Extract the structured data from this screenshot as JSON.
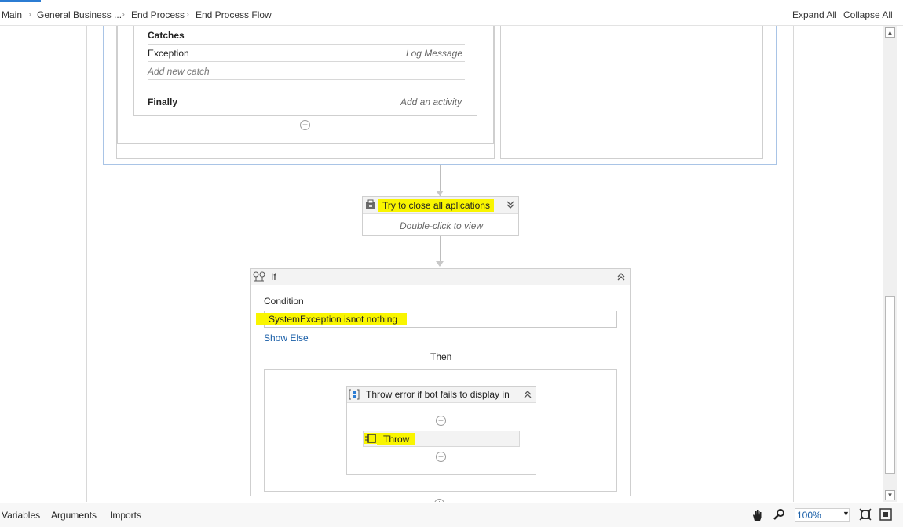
{
  "breadcrumb": [
    "Main",
    "General Business ...",
    "End Process",
    "End Process Flow"
  ],
  "header": {
    "expand_all": "Expand All",
    "collapse_all": "Collapse All"
  },
  "try_catch": {
    "catches_label": "Catches",
    "exception_label": "Exception",
    "exception_action": "Log Message",
    "add_catch": "Add new catch",
    "finally_label": "Finally",
    "finally_action": "Add an activity"
  },
  "close_apps": {
    "title": "Try to close all aplications",
    "hint": "Double-click to view"
  },
  "if_activity": {
    "title": "If",
    "condition_label": "Condition",
    "condition_value": "SystemException isnot nothing",
    "show_else": "Show Else",
    "then_label": "Then"
  },
  "sequence": {
    "title": "Throw error if bot fails to display in",
    "throw_label": "Throw"
  },
  "bottom_tabs": [
    "Variables",
    "Arguments",
    "Imports"
  ],
  "zoom": "100%",
  "colors": {
    "highlight": "#f9f500",
    "accent": "#2b7cd3",
    "link": "#1a5fa8"
  },
  "icons": [
    "chevron-right-icon",
    "plus-circle-icon",
    "sequence-icon",
    "expand-double-chevron-icon",
    "collapse-double-chevron-icon",
    "if-icon",
    "throw-icon",
    "hand-pan-icon",
    "zoom-icon",
    "fit-to-screen-icon",
    "reset-zoom-icon",
    "scroll-up-icon",
    "scroll-down-icon"
  ]
}
